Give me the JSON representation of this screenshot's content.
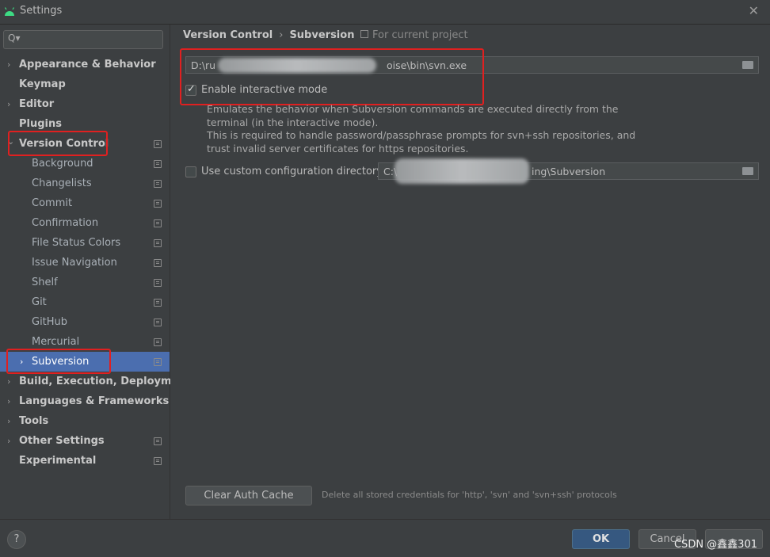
{
  "window": {
    "title": "Settings",
    "close_icon": "close-icon"
  },
  "search": {
    "placeholder": "Q▾"
  },
  "sidebar": {
    "items": [
      {
        "label": "Appearance & Behavior",
        "arrow": "›"
      },
      {
        "label": "Keymap"
      },
      {
        "label": "Editor",
        "arrow": "›"
      },
      {
        "label": "Plugins"
      },
      {
        "label": "Version Control",
        "arrow": "⌄"
      },
      {
        "label": "Background"
      },
      {
        "label": "Changelists"
      },
      {
        "label": "Commit"
      },
      {
        "label": "Confirmation"
      },
      {
        "label": "File Status Colors"
      },
      {
        "label": "Issue Navigation"
      },
      {
        "label": "Shelf"
      },
      {
        "label": "Git"
      },
      {
        "label": "GitHub"
      },
      {
        "label": "Mercurial"
      },
      {
        "label": "Subversion",
        "arrow": "›"
      },
      {
        "label": "Build, Execution, Deployment",
        "arrow": "›"
      },
      {
        "label": "Languages & Frameworks",
        "arrow": "›"
      },
      {
        "label": "Tools",
        "arrow": "›"
      },
      {
        "label": "Other Settings",
        "arrow": "›"
      },
      {
        "label": "Experimental"
      }
    ]
  },
  "breadcrumb": {
    "parent": "Version Control",
    "separator": "›",
    "current": "Subversion"
  },
  "scope": {
    "label": "For current project"
  },
  "svn_path": {
    "prefix": "D:\\ru",
    "suffix": "oise\\bin\\svn.exe"
  },
  "interactive": {
    "label": "Enable interactive mode",
    "checked": true,
    "description": [
      "Emulates the behavior when Subversion commands are executed directly from the",
      "terminal (in the interactive mode).",
      "This is required to handle password/passphrase prompts for svn+ssh repositories, and",
      "trust invalid server certificates for https repositories."
    ]
  },
  "config_dir": {
    "label": "Use custom configuration directory:",
    "checked": false,
    "prefix": "C:\\",
    "suffix": "ing\\Subversion"
  },
  "clear_auth": {
    "label": "Clear Auth Cache",
    "hint": "Delete all stored credentials for 'http', 'svn' and 'svn+ssh' protocols"
  },
  "footer": {
    "help": "?",
    "ok": "OK",
    "cancel": "Cancel",
    "watermark": "CSDN @鑫鑫301"
  },
  "colors": {
    "accent": "#4b6eaf",
    "highlight": "#e02020",
    "ok_button": "#365880"
  }
}
